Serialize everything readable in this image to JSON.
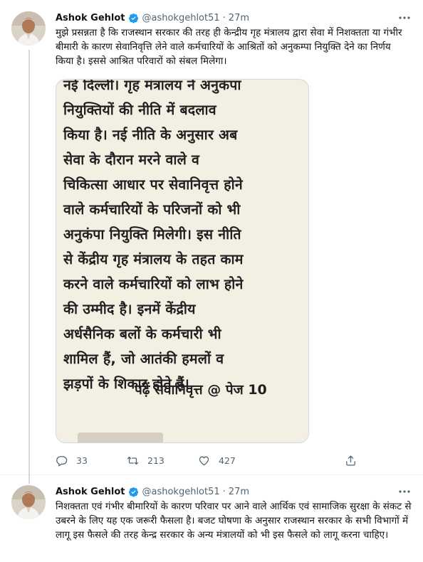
{
  "tweets": [
    {
      "author_name": "Ashok Gehlot",
      "handle": "@ashokgehlot51",
      "separator": "·",
      "time": "27m",
      "text": "मुझे प्रसन्नता है कि राजस्थान सरकार की तरह ही केन्द्रीय गृह मंत्रालय द्वारा सेवा में निशक्तता या गंभीर बीमारी के कारण सेवानिवृत्ति लेने वाले कर्मचारियों के आश्रितों को अनुकम्पा नियुक्ति देने का निर्णय किया है। इससे आश्रित परिवारों को संबल मिलेगा।",
      "media": {
        "lines": [
          "नई दिल्ली। गृह मंत्रालय ने अनुकंपा",
          "नियुक्तियों की नीति में बदलाव",
          "किया है। नई नीति के अनुसार अब",
          "सेवा के दौरान मरने वाले व",
          "चिकित्सा आधार पर सेवानिवृत्त होने",
          "वाले कर्मचारियों के परिजनों को भी",
          "अनुकंपा नियुक्ति मिलेगी। इस नीति",
          "से केंद्रीय गृह मंत्रालय के तहत काम",
          "करने वाले कर्मचारियों को लाभ होने",
          "की   उम्मीद  है। इनमें केंद्रीय",
          "अर्धसैनिक बलों के कर्मचारी भी",
          "शामिल हैं, जो आतंकी हमलों व",
          "झड़पों के शिकार होते हैं।"
        ],
        "reference": "पढ़ें सेवानिवृत्त @ पेज 10"
      },
      "actions": {
        "reply_count": "33",
        "retweet_count": "213",
        "like_count": "427"
      }
    },
    {
      "author_name": "Ashok Gehlot",
      "handle": "@ashokgehlot51",
      "separator": "·",
      "time": "27m",
      "text": "निशक्तता एवं गंभीर बीमारियों के कारण परिवार पर आने वाले आर्थिक एवं सामाजिक सुरक्षा के संकट से उबरने के लिए यह एक जरूरी फैसला है। बजट घोषणा के अनुसार राजस्थान सरकार के सभी विभागों में लागू इस फैसले की तरह केन्द्र सरकार के अन्य मंत्रालयों को भी इस फैसले को लागू करना चाहिए।"
    }
  ],
  "colors": {
    "verified": "#1d9bf0",
    "secondary_text": "#536471",
    "border": "#cfd9de"
  },
  "icons": {
    "more": "more-dots-icon",
    "reply": "reply-bubble-icon",
    "retweet": "retweet-arrows-icon",
    "like": "heart-icon",
    "share": "share-upload-icon",
    "verified": "verified-badge-icon"
  }
}
